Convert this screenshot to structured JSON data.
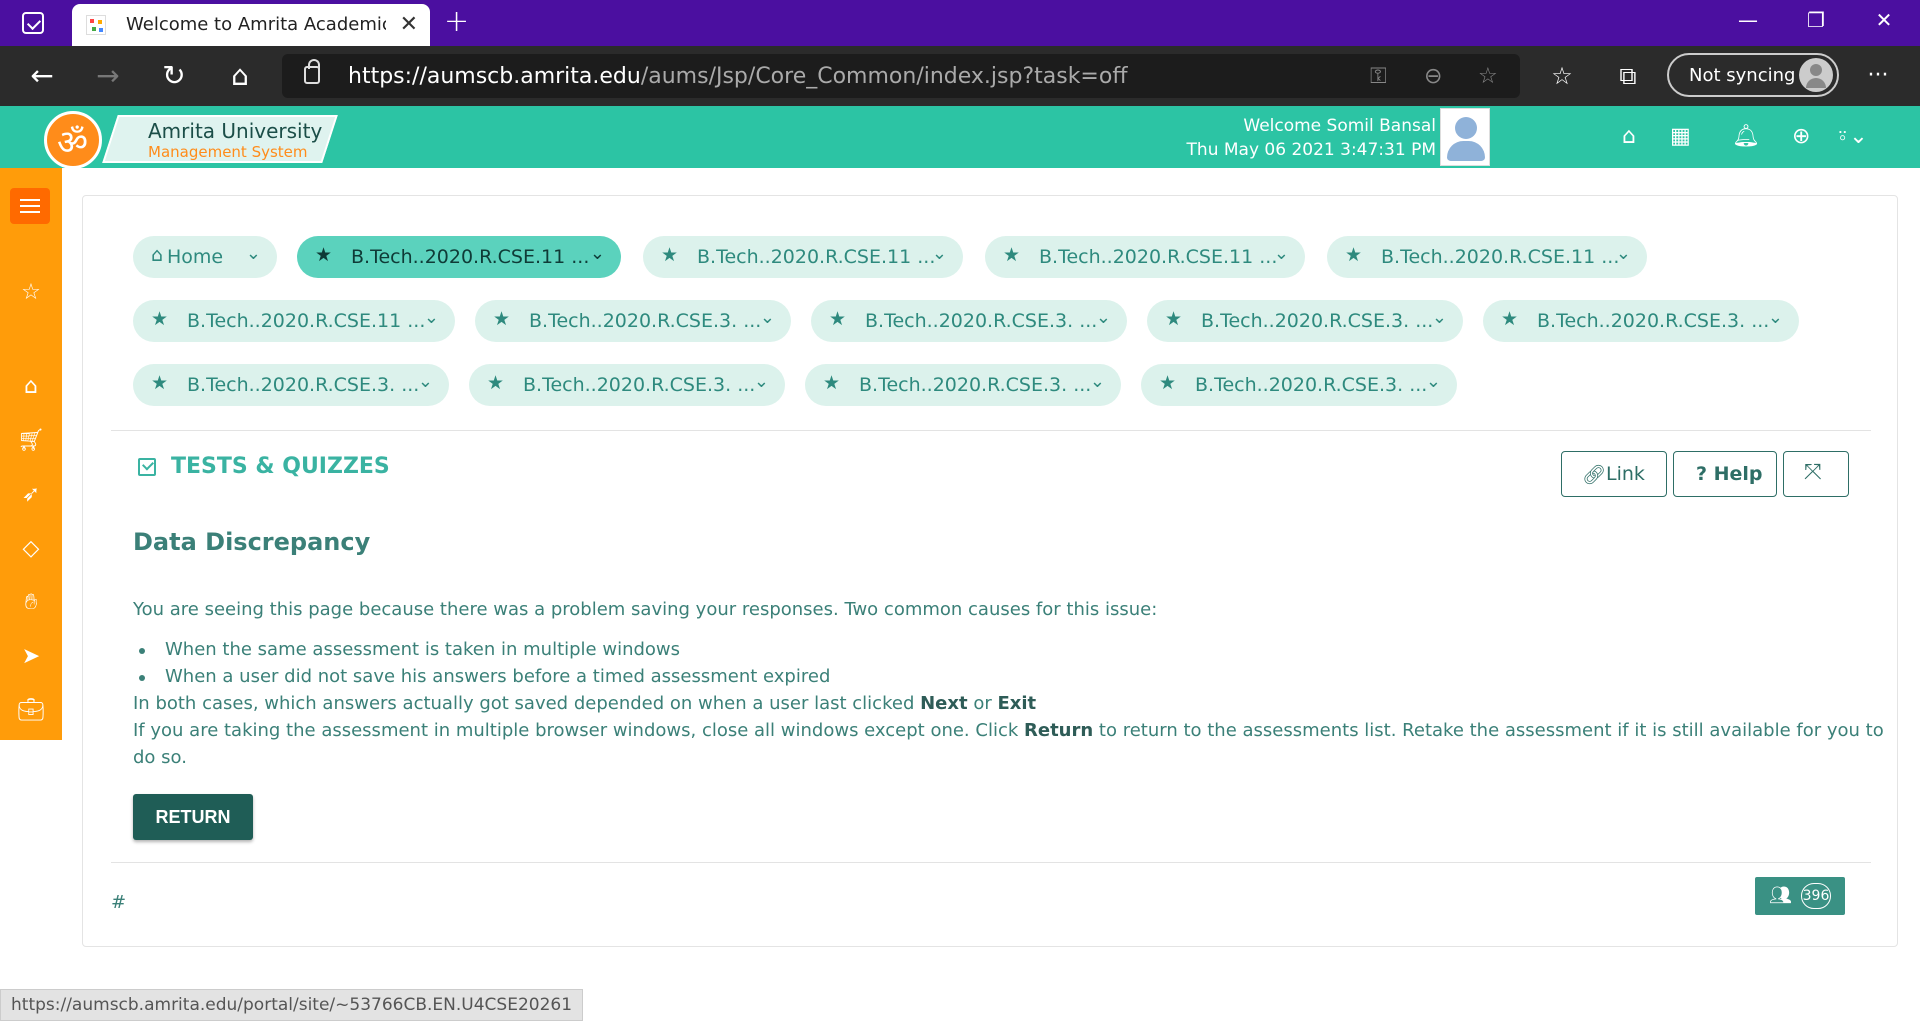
{
  "browser": {
    "tab_title": "Welcome to Amrita Academic Ma",
    "url_host": "https://aumscb.amrita.edu",
    "url_path": "/aums/Jsp/Core_Common/index.jsp?task=off",
    "sync_label": "Not syncing",
    "status_url": "https://aumscb.amrita.edu/portal/site/~53766CB.EN.U4CSE20261"
  },
  "header": {
    "logo_title": "Amrita University",
    "logo_subtitle": "Management System",
    "welcome": "Welcome Somil Bansal",
    "datetime": "Thu May 06 2021 3:47:31 PM",
    "accent_color": "#2cc4a4"
  },
  "crumbs": {
    "home": "Home",
    "row1": [
      "B.Tech..2020.R.CSE.11 ...",
      "B.Tech..2020.R.CSE.11 ...",
      "B.Tech..2020.R.CSE.11 ...",
      "B.Tech..2020.R.CSE.11 ..."
    ],
    "row2": [
      "B.Tech..2020.R.CSE.11 ...",
      "B.Tech..2020.R.CSE.3. ...",
      "B.Tech..2020.R.CSE.3. ...",
      "B.Tech..2020.R.CSE.3. ...",
      "B.Tech..2020.R.CSE.3. ..."
    ],
    "row3": [
      "B.Tech..2020.R.CSE.3. ...",
      "B.Tech..2020.R.CSE.3. ...",
      "B.Tech..2020.R.CSE.3. ...",
      "B.Tech..2020.R.CSE.3. ..."
    ]
  },
  "section": {
    "title": "TESTS & QUIZZES",
    "link_label": "Link",
    "help_label": "? Help"
  },
  "content": {
    "heading": "Data Discrepancy",
    "intro": "You are seeing this page because there was a problem saving your responses. Two common causes for this issue:",
    "bullets": [
      "When the same assessment is taken in multiple windows",
      "When a user did not save his answers before a timed assessment expired"
    ],
    "p2_a": "In both cases, which answers actually got saved depended on when a user last clicked ",
    "p2_next": "Next",
    "p2_or": " or ",
    "p2_exit": "Exit",
    "p3_a": "If you are taking the assessment in multiple browser windows, close all windows except one. Click ",
    "p3_return": "Return",
    "p3_b": " to return to the assessments list. Retake the assessment if it is still available for you to do so.",
    "return_button": "RETURN"
  },
  "footer": {
    "hash": "#",
    "user_count": "396"
  }
}
